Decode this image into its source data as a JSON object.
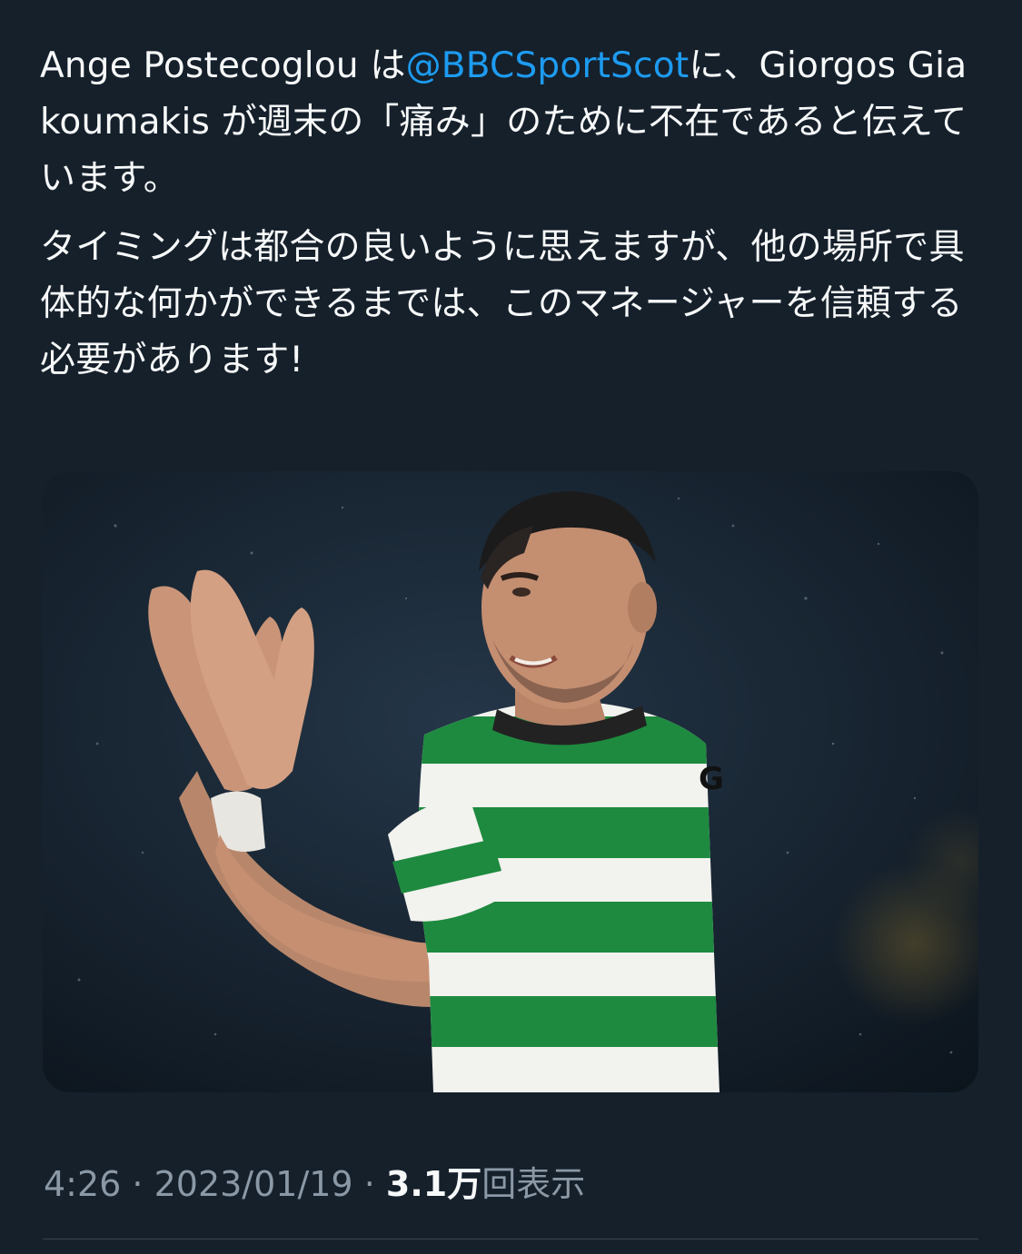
{
  "tweet": {
    "paragraph1": {
      "before": "Ange Postecoglou は",
      "mention": "@BBCSportScot",
      "after": "に、Giorgos Giakoumakis が週末の「痛み」のために不在であると伝えています。"
    },
    "paragraph2": "タイミングは都合の良いように思えますが、他の場所で具体的な何かができるまでは、このマネージャーを信頼する必要があります!"
  },
  "media": {
    "jersey_letter": "G"
  },
  "meta": {
    "time": "4:26",
    "separator1": " · ",
    "date": "2023/01/19",
    "separator2": " · ",
    "views_count": "3.1万",
    "views_label": "回表示"
  },
  "colors": {
    "background": "#15202b",
    "text": "#f7f9f9",
    "mention": "#1d9bf0",
    "meta": "#8b98a5"
  }
}
